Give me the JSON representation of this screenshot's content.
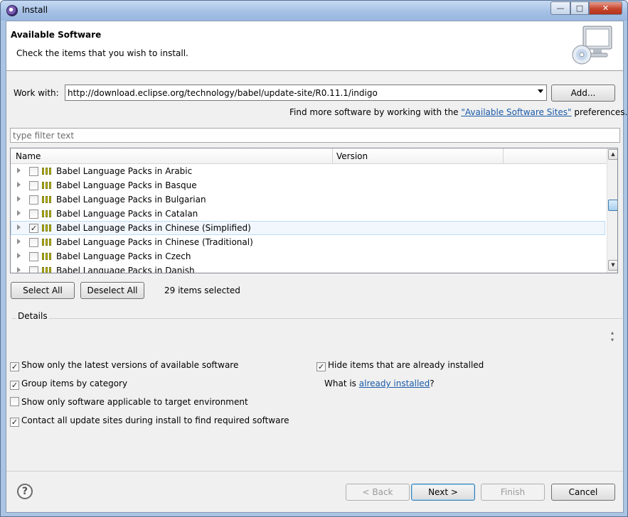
{
  "window": {
    "title": "Install",
    "minimize": "—",
    "maximize": "□",
    "close": "✕"
  },
  "header": {
    "title": "Available Software",
    "subtitle": "Check the items that you wish to install."
  },
  "work_with": {
    "label": "Work with:",
    "value": "http://download.eclipse.org/technology/babel/update-site/R0.11.1/indigo",
    "add_button": "Add..."
  },
  "find_more": {
    "prefix": "Find more software by working with the ",
    "link": "\"Available Software Sites\"",
    "suffix": " preferences."
  },
  "filter": {
    "placeholder": "type filter text"
  },
  "tree": {
    "columns": [
      "Name",
      "Version"
    ],
    "items": [
      {
        "name": "Babel Language Packs in Arabic",
        "checked": false
      },
      {
        "name": "Babel Language Packs in Basque",
        "checked": false
      },
      {
        "name": "Babel Language Packs in Bulgarian",
        "checked": false
      },
      {
        "name": "Babel Language Packs in Catalan",
        "checked": false
      },
      {
        "name": "Babel Language Packs in Chinese (Simplified)",
        "checked": true
      },
      {
        "name": "Babel Language Packs in Chinese (Traditional)",
        "checked": false
      },
      {
        "name": "Babel Language Packs in Czech",
        "checked": false
      },
      {
        "name": "Babel Language Packs in Danish",
        "checked": false
      }
    ]
  },
  "selection": {
    "select_all": "Select All",
    "deselect_all": "Deselect All",
    "status": "29 items selected"
  },
  "details": {
    "label": "Details"
  },
  "options": {
    "latest_versions": {
      "label": "Show only the latest versions of available software",
      "checked": true
    },
    "group_by_category": {
      "label": "Group items by category",
      "checked": true
    },
    "target_env": {
      "label": "Show only software applicable to target environment",
      "checked": false
    },
    "contact_sites": {
      "label": "Contact all update sites during install to find required software",
      "checked": true
    },
    "hide_installed": {
      "label": "Hide items that are already installed",
      "checked": true
    }
  },
  "what_is": {
    "prefix": "What is ",
    "link": "already installed",
    "suffix": "?"
  },
  "footer": {
    "help": "?",
    "back": "< Back",
    "next": "Next >",
    "finish": "Finish",
    "cancel": "Cancel"
  },
  "icons": {
    "app": "eclipse-icon",
    "banner": "monitor-cd-icon",
    "package": "feature-package-icon",
    "help": "help-icon"
  }
}
